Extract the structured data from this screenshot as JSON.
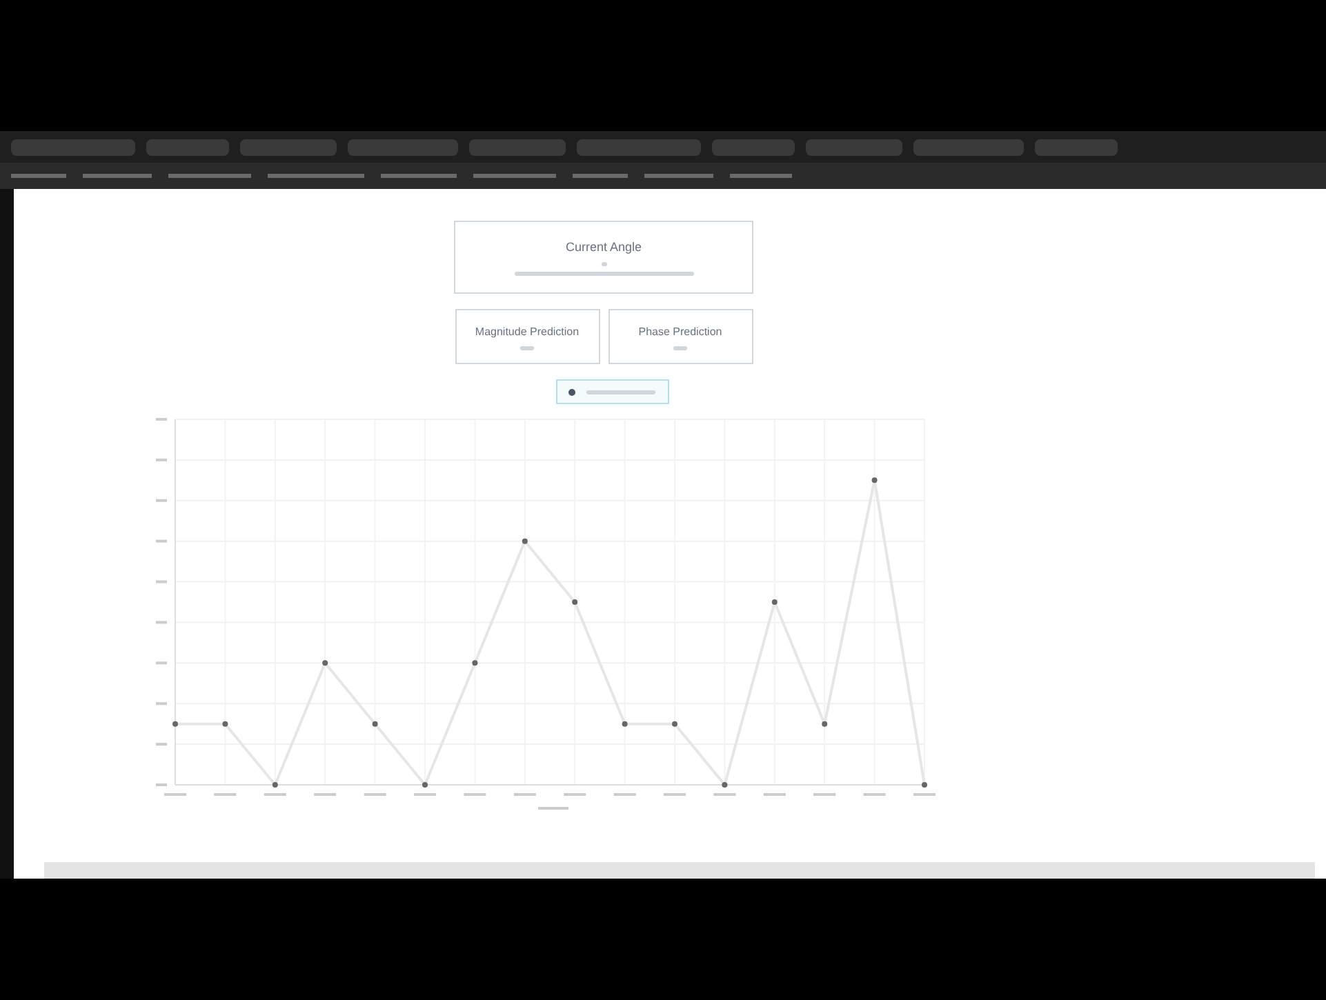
{
  "angle_card": {
    "title": "Current Angle"
  },
  "prediction_cards": [
    {
      "title": "Magnitude Prediction"
    },
    {
      "title": "Phase Prediction"
    }
  ]
}
